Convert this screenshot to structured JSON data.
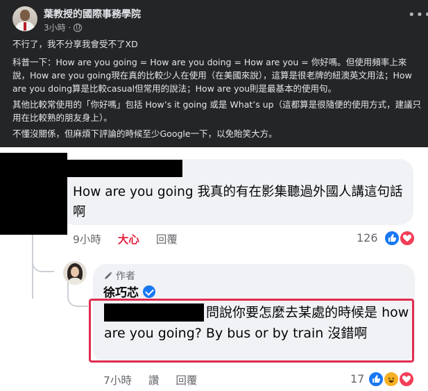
{
  "post": {
    "author": "葉教授的國際事務學院",
    "time": "3小時",
    "more_icon": "more-horizontal-icon",
    "privacy_icon": "globe-icon",
    "paragraphs": [
      "不行了，我不分享我會受不了XD",
      "科普一下：How are you going = How are you doing = How are you = 你好嗎。但使用頻率上來說，How are you going現在真的比較少人在使用（在美國來說），這算是很老牌的紐澳英文用法；How are you doing算是比較casual但常用的說法；How are you則是最基本的使用句。",
      "其他比較常使用的「你好嗎」包括 How’s it going 或是 What’s up（這都算是很隨便的使用方式，建議只用在比較熟的朋友身上）。",
      "不懂沒關係，但麻煩下評論的時候至少Google一下，以免貽笑大方。"
    ]
  },
  "comment1": {
    "text": "How are you going 我真的有在影集聽過外國人講這句話啊",
    "time": "9小時",
    "reaction_label": "大心",
    "reply_label": "回覆",
    "reaction_count": "126",
    "reactions": [
      "like-icon",
      "heart-icon"
    ]
  },
  "comment2": {
    "badge": "作者",
    "badge_icon": "pencil-icon",
    "author": "徐巧芯",
    "verified_icon": "verified-badge-icon",
    "text_part1": "問說你要怎麼去某處的時候是",
    "text_part2": "how are you going? By bus or by train 沒錯啊",
    "time": "7小時",
    "like_label": "讚",
    "reply_label": "回覆",
    "reaction_count": "17",
    "reactions": [
      "like-icon",
      "haha-icon",
      "heart-icon"
    ]
  },
  "colors": {
    "dark_bg": "#242526",
    "comment_bubble": "#f0f2f5",
    "highlight_border": "#e12c4f",
    "love_text": "#e41e3f",
    "like_blue": "#1877f2"
  }
}
